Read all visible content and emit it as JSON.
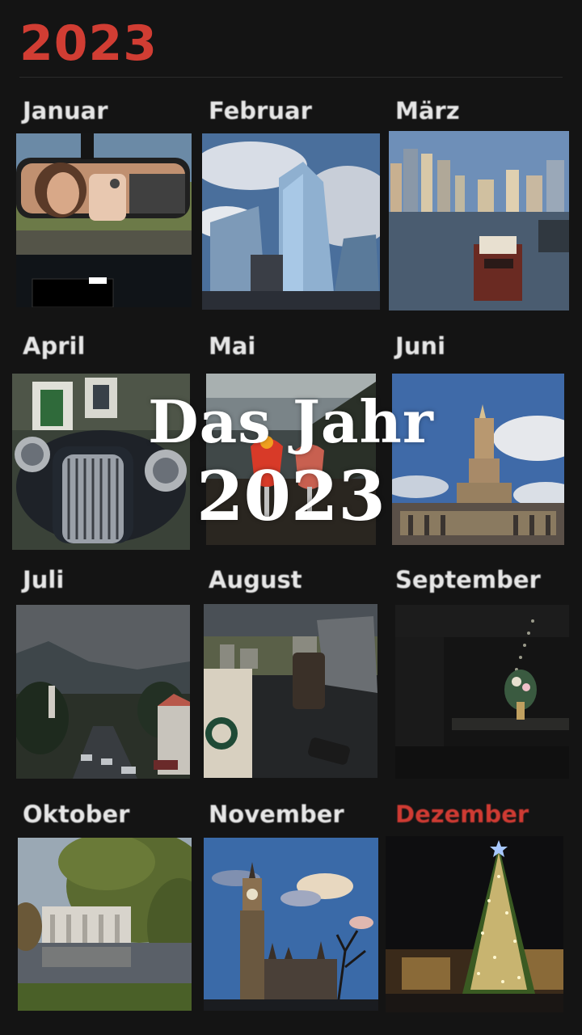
{
  "header": {
    "year": "2023"
  },
  "overlay": {
    "line1": "Das Jahr",
    "line2": "2023"
  },
  "months": [
    {
      "label": "Januar",
      "photo": "car-mirror-selfie"
    },
    {
      "label": "Februar",
      "photo": "glass-skyscrapers"
    },
    {
      "label": "März",
      "photo": "dubai-marina"
    },
    {
      "label": "April",
      "photo": "vintage-car"
    },
    {
      "label": "Mai",
      "photo": "cocktails"
    },
    {
      "label": "Juni",
      "photo": "palace-of-culture"
    },
    {
      "label": "Juli",
      "photo": "mountain-town-street"
    },
    {
      "label": "August",
      "photo": "starbucks-laptop-view"
    },
    {
      "label": "September",
      "photo": "dark-room-bouquet"
    },
    {
      "label": "Oktober",
      "photo": "lakeside-palace"
    },
    {
      "label": "November",
      "photo": "big-ben"
    },
    {
      "label": "Dezember",
      "photo": "christmas-tree"
    }
  ],
  "colors": {
    "accent": "#d13d33",
    "background": "#141414",
    "label": "#e6e6e6"
  }
}
